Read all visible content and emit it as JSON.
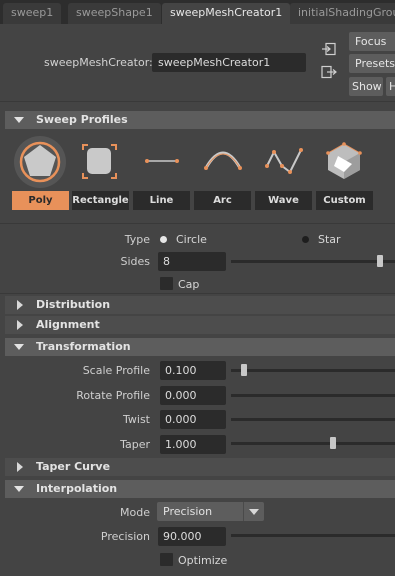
{
  "tabs": [
    {
      "label": "sweep1",
      "active": false
    },
    {
      "label": "sweepShape1",
      "active": false
    },
    {
      "label": "sweepMeshCreator1",
      "active": true
    },
    {
      "label": "initialShadingGroup",
      "active": false
    }
  ],
  "node": {
    "label": "sweepMeshCreator:",
    "name": "sweepMeshCreator1"
  },
  "side_buttons": {
    "focus": "Focus",
    "presets": "Presets",
    "show": "Show",
    "hide": "Hide"
  },
  "sections": {
    "sweep_profiles": "Sweep Profiles",
    "distribution": "Distribution",
    "alignment": "Alignment",
    "transformation": "Transformation",
    "taper_curve": "Taper Curve",
    "interpolation": "Interpolation"
  },
  "profiles": [
    {
      "label": "Poly",
      "icon": "poly-profile-icon",
      "selected": true
    },
    {
      "label": "Rectangle",
      "icon": "rectangle-profile-icon",
      "selected": false
    },
    {
      "label": "Line",
      "icon": "line-profile-icon",
      "selected": false
    },
    {
      "label": "Arc",
      "icon": "arc-profile-icon",
      "selected": false
    },
    {
      "label": "Wave",
      "icon": "wave-profile-icon",
      "selected": false
    },
    {
      "label": "Custom",
      "icon": "custom-profile-icon",
      "selected": false
    }
  ],
  "poly": {
    "type_label": "Type",
    "type_options": [
      "Circle",
      "Star"
    ],
    "type_selected": "Circle",
    "sides_label": "Sides",
    "sides_value": "8",
    "sides_slider": 0.98,
    "cap_label": "Cap",
    "cap_checked": false
  },
  "transformation": {
    "scale_label": "Scale Profile",
    "scale_value": "0.100",
    "scale_slider": 0.06,
    "rotate_label": "Rotate Profile",
    "rotate_value": "0.000",
    "twist_label": "Twist",
    "twist_value": "0.000",
    "taper_label": "Taper",
    "taper_value": "1.000",
    "taper_slider": 0.6
  },
  "interpolation": {
    "mode_label": "Mode",
    "mode_value": "Precision",
    "precision_label": "Precision",
    "precision_value": "90.000",
    "optimize_label": "Optimize",
    "optimize_checked": false
  },
  "colors": {
    "accent": "#e8915a",
    "background": "#444444",
    "field": "#2b2b2b",
    "section_header": "#5d5d5d"
  }
}
